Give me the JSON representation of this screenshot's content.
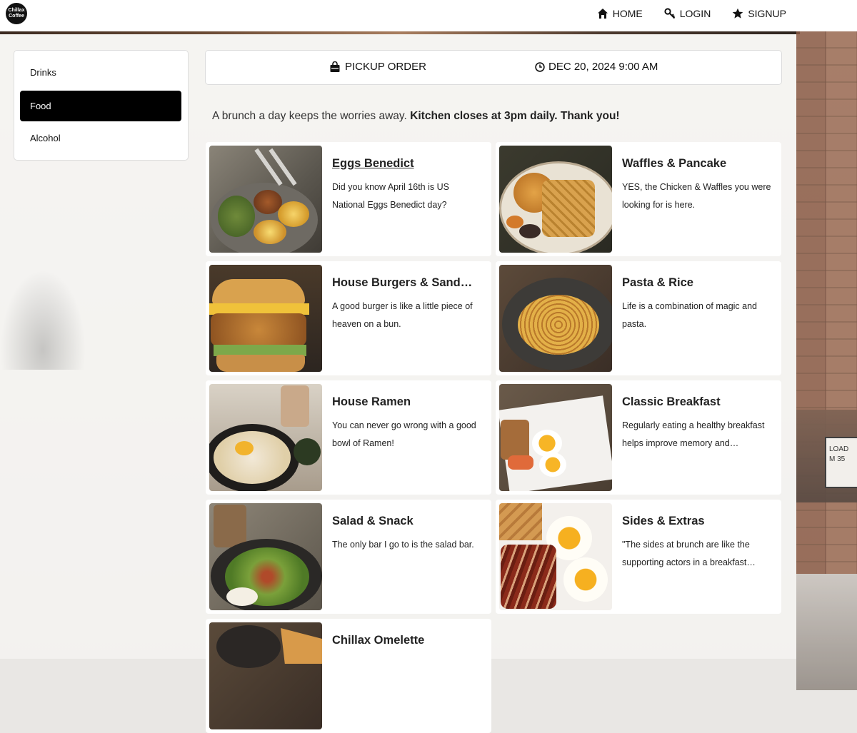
{
  "brand": {
    "logo_text": "Chillax Coffee"
  },
  "nav": {
    "home": "HOME",
    "login": "LOGIN",
    "signup": "SIGNUP"
  },
  "sidebar": {
    "items": [
      {
        "label": "Drinks",
        "active": false
      },
      {
        "label": "Food",
        "active": true
      },
      {
        "label": "Alcohol",
        "active": false
      }
    ]
  },
  "order": {
    "type": "PICKUP ORDER",
    "datetime": "DEC 20, 2024 9:00 AM"
  },
  "intro": {
    "text": "A brunch a day keeps the worries away.",
    "notice": "Kitchen closes at 3pm daily. Thank you!"
  },
  "menu": [
    {
      "title": "Eggs Benedict",
      "desc": "Did you know April 16th is US National Eggs Benedict day?",
      "image": "eggs-benedict-photo"
    },
    {
      "title": "Waffles & Pancake",
      "desc": "YES, the Chicken & Waffles you were looking for is here.",
      "image": "chicken-waffles-photo"
    },
    {
      "title": "House Burgers & Sandwiches",
      "desc": "A good burger is like a little piece of heaven on a bun.",
      "image": "burger-photo"
    },
    {
      "title": "Pasta & Rice",
      "desc": "Life is a combination of magic and pasta.",
      "image": "pasta-photo"
    },
    {
      "title": "House Ramen",
      "desc": "You can never go wrong with a good bowl of Ramen!",
      "image": "ramen-photo"
    },
    {
      "title": "Classic Breakfast",
      "desc": "Regularly eating a healthy breakfast helps improve memory and concentration.",
      "image": "breakfast-photo"
    },
    {
      "title": "Salad & Snack",
      "desc": "The only bar I go to is the salad bar.",
      "image": "salad-photo"
    },
    {
      "title": "Sides & Extras",
      "desc": "\"The sides at brunch are like the supporting actors in a breakfast movie.\"",
      "image": "bacon-eggs-photo"
    },
    {
      "title": "Chillax Omelette",
      "desc": "",
      "image": "omelette-photo"
    }
  ],
  "background_sign": {
    "line1": "LOAD",
    "line2": "M 35"
  },
  "colors": {
    "active_bg": "#000000",
    "card_bg": "#ffffff",
    "page_bg": "#f3f1ef"
  }
}
